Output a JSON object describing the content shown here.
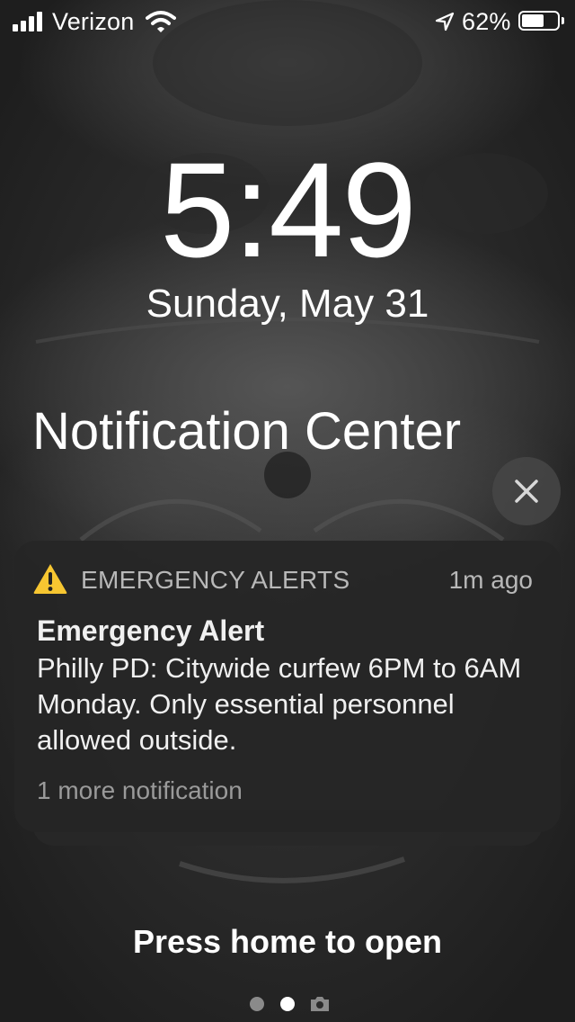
{
  "status_bar": {
    "carrier": "Verizon",
    "battery_percent": "62%",
    "battery_level": 0.62,
    "icons": [
      "signal-bars-icon",
      "wifi-icon",
      "location-arrow-icon",
      "battery-icon"
    ]
  },
  "lock_screen": {
    "time": "5:49",
    "date": "Sunday, May 31",
    "notification_center_title": "Notification Center"
  },
  "notification": {
    "app_name": "EMERGENCY ALERTS",
    "time_ago": "1m ago",
    "title": "Emergency Alert",
    "body": "Philly PD: Citywide curfew 6PM to 6AM Monday. Only essential personnel allowed outside.",
    "more": "1 more notification",
    "icon": "warning-triangle-icon",
    "icon_color": "#F7C631"
  },
  "footer": {
    "press_home": "Press home to open",
    "page_indicator": [
      "page-dot",
      "page-dot-current",
      "camera-icon"
    ]
  }
}
